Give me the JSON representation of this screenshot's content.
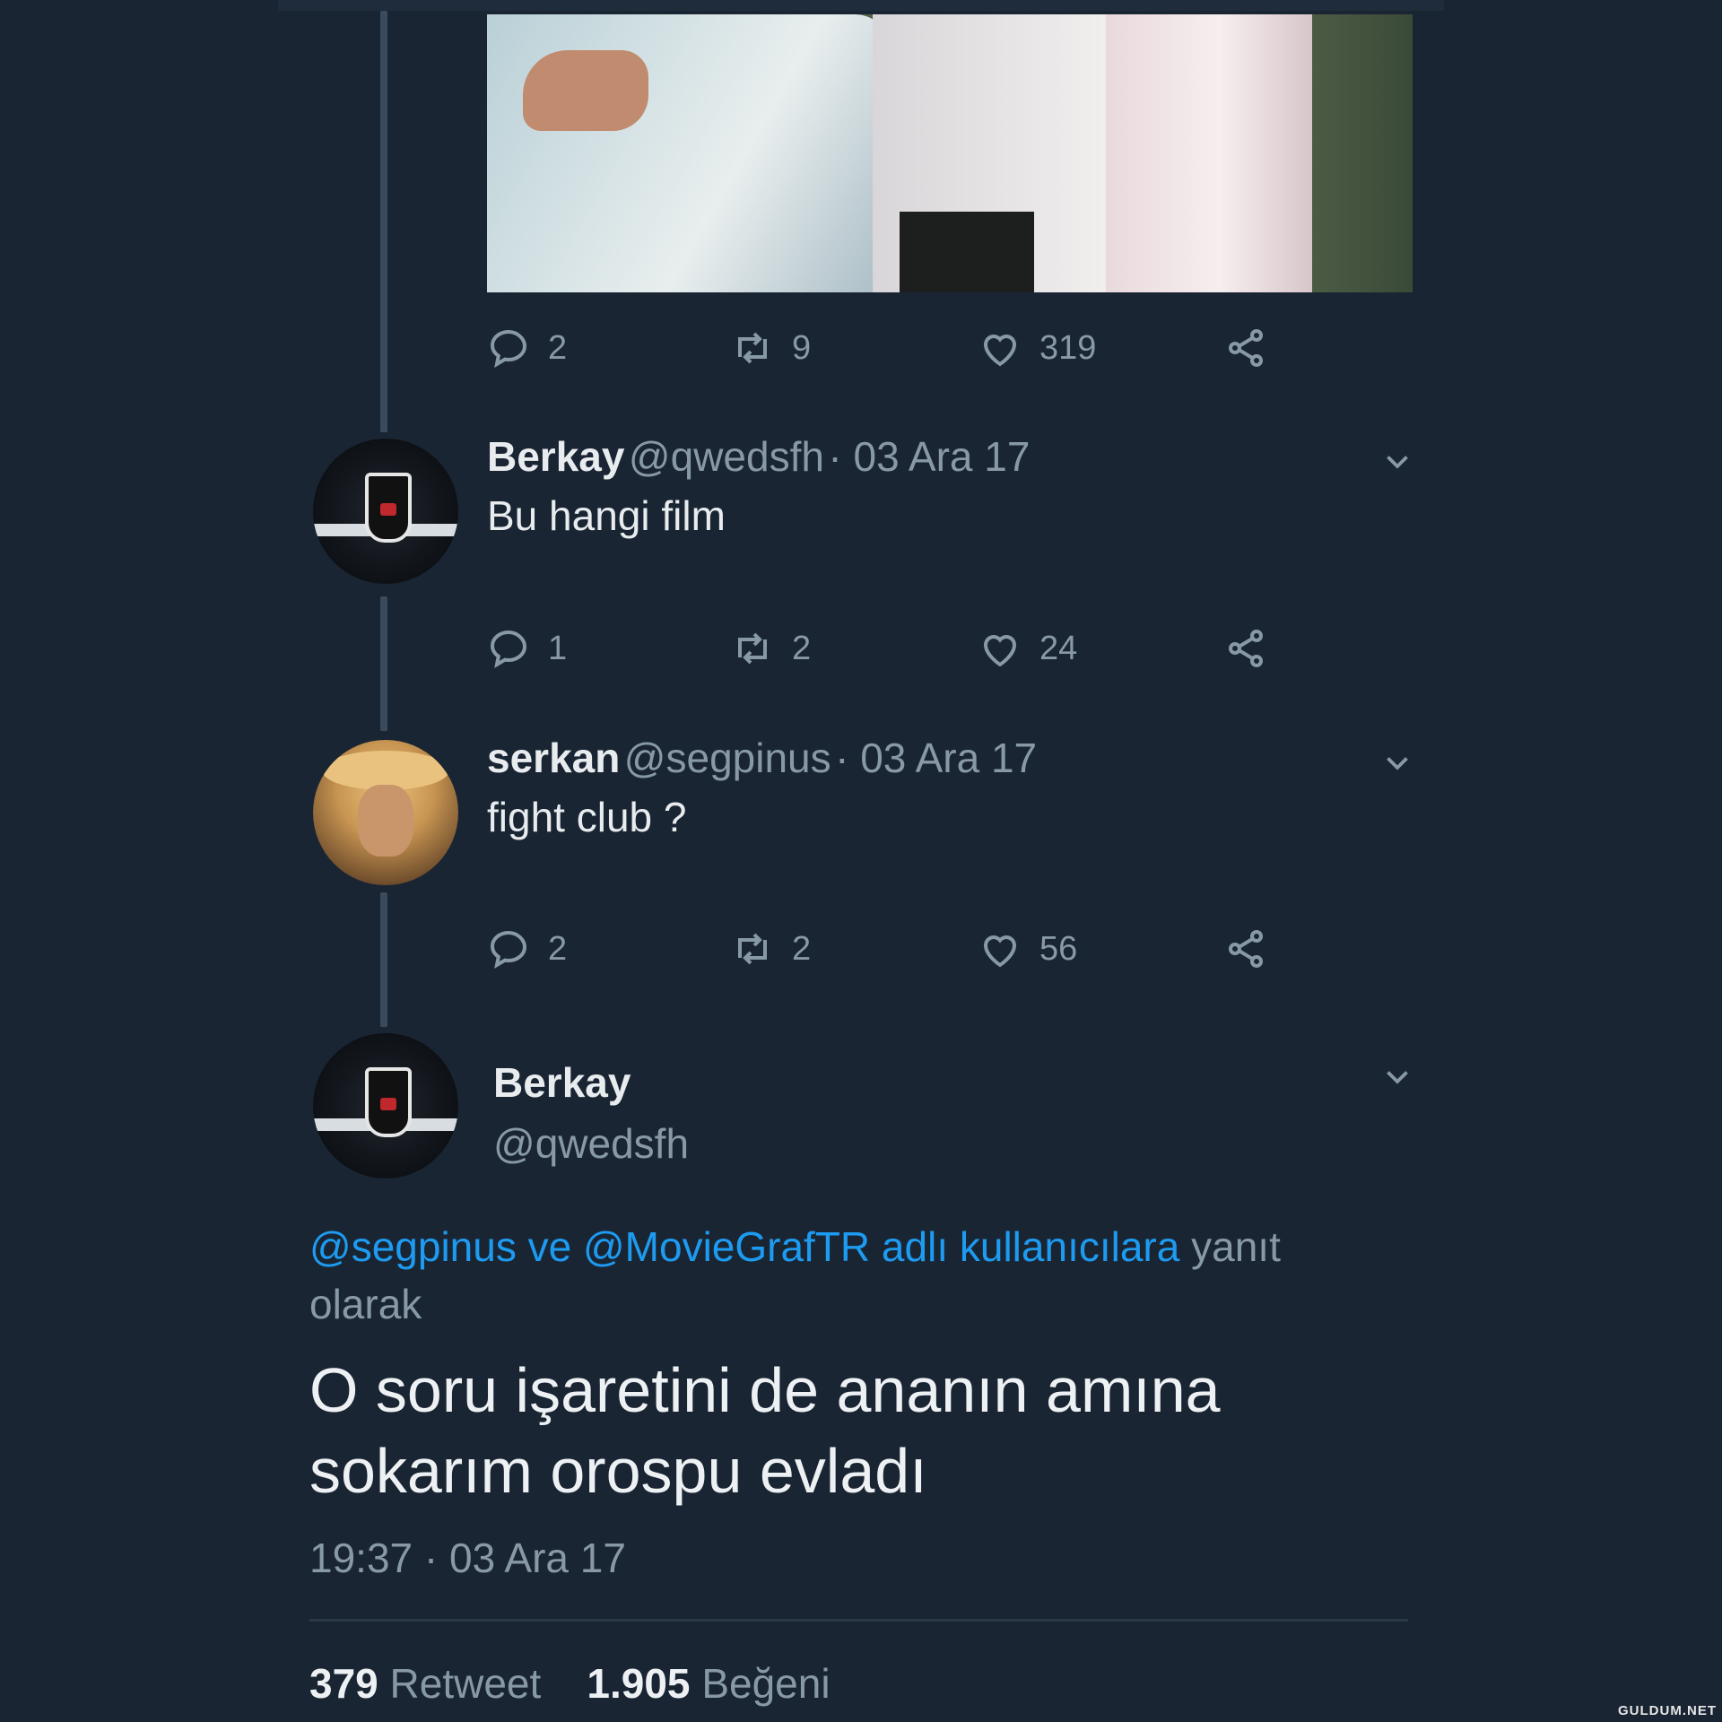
{
  "thread": {
    "first_actions": {
      "replies": "2",
      "retweets": "9",
      "likes": "319"
    },
    "tweets": [
      {
        "name": "Berkay",
        "handle": "@qwedsfh",
        "date": "· 03 Ara 17",
        "text": "Bu hangi film",
        "actions": {
          "replies": "1",
          "retweets": "2",
          "likes": "24"
        }
      },
      {
        "name": "serkan",
        "handle": "@segpinus",
        "date": "· 03 Ara 17",
        "text": "fight club ?",
        "actions": {
          "replies": "2",
          "retweets": "2",
          "likes": "56"
        }
      }
    ]
  },
  "main_tweet": {
    "name": "Berkay",
    "handle": "@qwedsfh",
    "reply_to_links": "@segpinus ve @MovieGrafTR adlı kullanıcılara",
    "reply_to_suffix": "yanıt olarak",
    "text_line1": "O soru işaretini de ananın amına",
    "text_line2": "sokarım orospu evladı",
    "timestamp": "19:37 · 03 Ara 17",
    "retweet_count": "379",
    "retweet_label": "Retweet",
    "like_count": "1.905",
    "like_label": "Beğeni"
  },
  "watermark": "GULDUM.NET",
  "icons": [
    "reply-icon",
    "retweet-icon",
    "like-icon",
    "share-icon",
    "chevron-down-icon"
  ]
}
